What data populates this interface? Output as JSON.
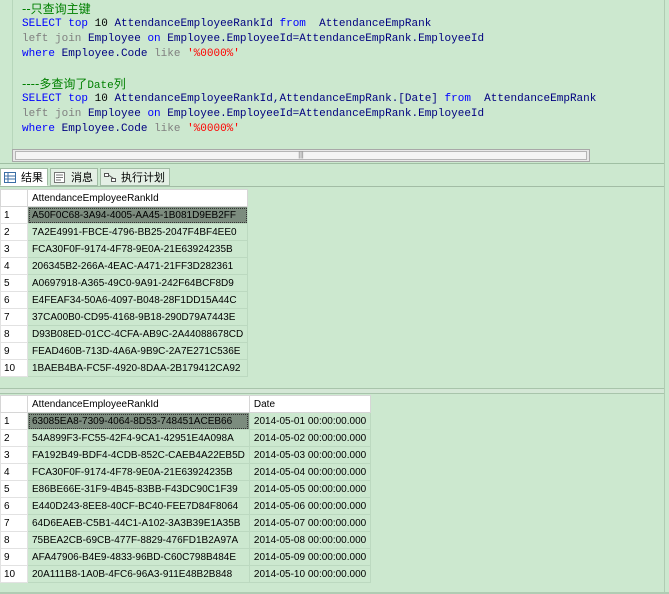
{
  "editor": {
    "line1": {
      "comment": "--只查询主键"
    },
    "line2": {
      "kw1": "SELECT",
      "kw2": "top",
      "num": "10",
      "col": "AttendanceEmployeeRankId",
      "kw3": "from",
      "table": "AttendanceEmpRank"
    },
    "line3": {
      "join": "left join",
      "table": "Employee",
      "on": "on",
      "cond": "Employee.EmployeeId=AttendanceEmpRank.EmployeeId"
    },
    "line4": {
      "where": "where",
      "col": "Employee.Code",
      "like": "like",
      "str": "'%0000%'"
    },
    "line6": {
      "comment_prefix": "----多查询了",
      "comment_date": "Date",
      "comment_suffix": "列"
    },
    "line7": {
      "kw1": "SELECT",
      "kw2": "top",
      "num": "10",
      "cols": "AttendanceEmployeeRankId,AttendanceEmpRank.[Date]",
      "kw3": "from",
      "table": "AttendanceEmpRank"
    },
    "line8": {
      "join": "left join",
      "table": "Employee",
      "on": "on",
      "cond": "Employee.EmployeeId=AttendanceEmpRank.EmployeeId"
    },
    "line9": {
      "where": "where",
      "col": "Employee.Code",
      "like": "like",
      "str": "'%0000%'"
    },
    "scroll_glyph": "|||"
  },
  "tabs": {
    "results": "结果",
    "messages": "消息",
    "plan": "执行计划"
  },
  "grid1": {
    "header": "AttendanceEmployeeRankId",
    "rows": [
      {
        "n": "1",
        "id": "A50F0C68-3A94-4005-AA45-1B081D9EB2FF"
      },
      {
        "n": "2",
        "id": "7A2E4991-FBCE-4796-BB25-2047F4BF4EE0"
      },
      {
        "n": "3",
        "id": "FCA30F0F-9174-4F78-9E0A-21E63924235B"
      },
      {
        "n": "4",
        "id": "206345B2-266A-4EAC-A471-21FF3D282361"
      },
      {
        "n": "5",
        "id": "A0697918-A365-49C0-9A91-242F64BCF8D9"
      },
      {
        "n": "6",
        "id": "E4FEAF34-50A6-4097-B048-28F1DD15A44C"
      },
      {
        "n": "7",
        "id": "37CA00B0-CD95-4168-9B18-290D79A7443E"
      },
      {
        "n": "8",
        "id": "D93B08ED-01CC-4CFA-AB9C-2A44088678CD"
      },
      {
        "n": "9",
        "id": "FEAD460B-713D-4A6A-9B9C-2A7E271C536E"
      },
      {
        "n": "10",
        "id": "1BAEB4BA-FC5F-4920-8DAA-2B179412CA92"
      }
    ]
  },
  "grid2": {
    "header_id": "AttendanceEmployeeRankId",
    "header_date": "Date",
    "rows": [
      {
        "n": "1",
        "id": "63085EA8-7309-4064-8D53-748451ACEB66",
        "date": "2014-05-01 00:00:00.000"
      },
      {
        "n": "2",
        "id": "54A899F3-FC55-42F4-9CA1-42951E4A098A",
        "date": "2014-05-02 00:00:00.000"
      },
      {
        "n": "3",
        "id": "FA192B49-BDF4-4CDB-852C-CAEB4A22EB5D",
        "date": "2014-05-03 00:00:00.000"
      },
      {
        "n": "4",
        "id": "FCA30F0F-9174-4F78-9E0A-21E63924235B",
        "date": "2014-05-04 00:00:00.000"
      },
      {
        "n": "5",
        "id": "E86BE66E-31F9-4B45-83BB-F43DC90C1F39",
        "date": "2014-05-05 00:00:00.000"
      },
      {
        "n": "6",
        "id": "E440D243-8EE8-40CF-BC40-FEE7D84F8064",
        "date": "2014-05-06 00:00:00.000"
      },
      {
        "n": "7",
        "id": "64D6EAEB-C5B1-44C1-A102-3A3B39E1A35B",
        "date": "2014-05-07 00:00:00.000"
      },
      {
        "n": "8",
        "id": "75BEA2CB-69CB-477F-8829-476FD1B2A97A",
        "date": "2014-05-08 00:00:00.000"
      },
      {
        "n": "9",
        "id": "AFA47906-B4E9-4833-96BD-C60C798B484E",
        "date": "2014-05-09 00:00:00.000"
      },
      {
        "n": "10",
        "id": "20A111B8-1A0B-4FC6-96A3-911E48B2B848",
        "date": "2014-05-10 00:00:00.000"
      }
    ]
  },
  "colors": {
    "background": "#cce8cf",
    "keyword": "#0000ff",
    "comment": "#008000",
    "string": "#ff0000",
    "selected": "#7c8c7e"
  }
}
